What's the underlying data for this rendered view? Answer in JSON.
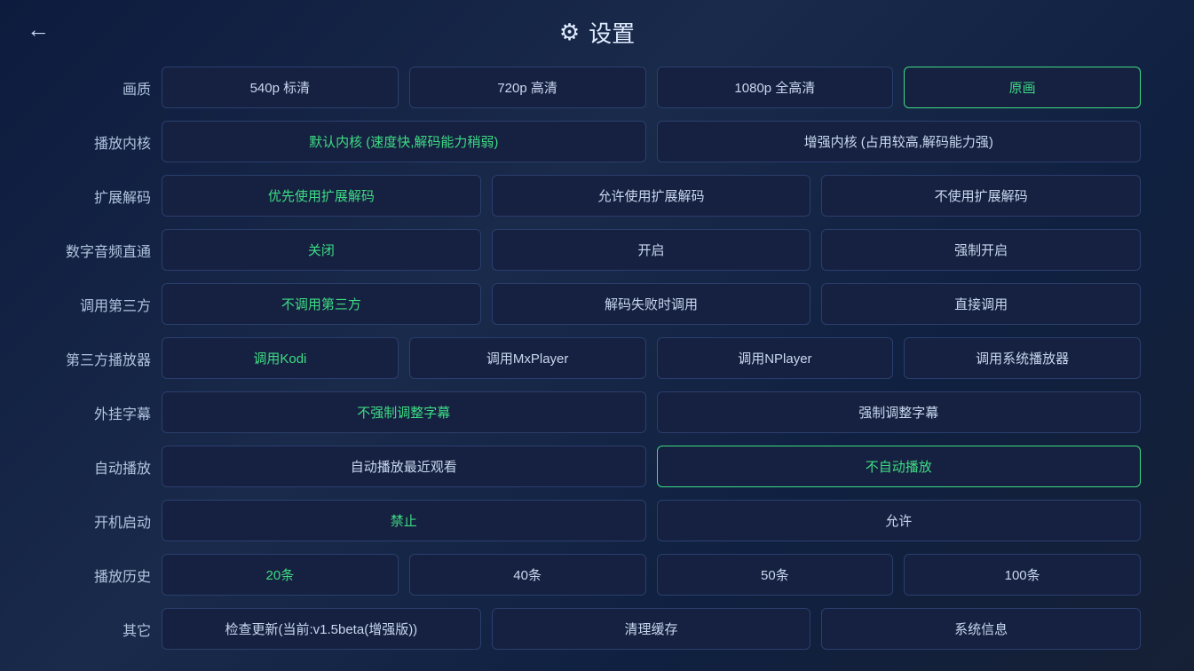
{
  "header": {
    "back_label": "←",
    "gear_symbol": "⚙",
    "title": "设置"
  },
  "rows": [
    {
      "label": "画质",
      "options": [
        {
          "text": "540p 标清",
          "state": "normal"
        },
        {
          "text": "720p 高清",
          "state": "normal"
        },
        {
          "text": "1080p 全高清",
          "state": "normal"
        },
        {
          "text": "原画",
          "state": "active-border-green"
        }
      ]
    },
    {
      "label": "播放内核",
      "options": [
        {
          "text": "默认内核 (速度快,解码能力稍弱)",
          "state": "active-green",
          "flex": 1
        },
        {
          "text": "增强内核 (占用较高,解码能力强)",
          "state": "normal",
          "flex": 1
        }
      ]
    },
    {
      "label": "扩展解码",
      "options": [
        {
          "text": "优先使用扩展解码",
          "state": "active-green"
        },
        {
          "text": "允许使用扩展解码",
          "state": "normal"
        },
        {
          "text": "不使用扩展解码",
          "state": "normal"
        }
      ]
    },
    {
      "label": "数字音频直通",
      "options": [
        {
          "text": "关闭",
          "state": "active-green"
        },
        {
          "text": "开启",
          "state": "normal"
        },
        {
          "text": "强制开启",
          "state": "normal"
        }
      ]
    },
    {
      "label": "调用第三方",
      "options": [
        {
          "text": "不调用第三方",
          "state": "active-green"
        },
        {
          "text": "解码失败时调用",
          "state": "normal"
        },
        {
          "text": "直接调用",
          "state": "normal"
        }
      ]
    },
    {
      "label": "第三方播放器",
      "options": [
        {
          "text": "调用Kodi",
          "state": "active-green"
        },
        {
          "text": "调用MxPlayer",
          "state": "normal"
        },
        {
          "text": "调用NPlayer",
          "state": "normal"
        },
        {
          "text": "调用系统播放器",
          "state": "normal"
        }
      ]
    },
    {
      "label": "外挂字幕",
      "options": [
        {
          "text": "不强制调整字幕",
          "state": "active-green",
          "flex": 1
        },
        {
          "text": "强制调整字幕",
          "state": "normal",
          "flex": 1
        }
      ]
    },
    {
      "label": "自动播放",
      "options": [
        {
          "text": "自动播放最近观看",
          "state": "normal",
          "flex": 1
        },
        {
          "text": "不自动播放",
          "state": "active-border-green",
          "flex": 1
        }
      ]
    },
    {
      "label": "开机启动",
      "options": [
        {
          "text": "禁止",
          "state": "active-green",
          "flex": 1
        },
        {
          "text": "允许",
          "state": "normal",
          "flex": 1
        }
      ]
    },
    {
      "label": "播放历史",
      "options": [
        {
          "text": "20条",
          "state": "active-green"
        },
        {
          "text": "40条",
          "state": "normal"
        },
        {
          "text": "50条",
          "state": "normal"
        },
        {
          "text": "100条",
          "state": "normal"
        }
      ]
    },
    {
      "label": "其它",
      "options": [
        {
          "text": "检查更新(当前:v1.5beta(增强版))",
          "state": "normal",
          "flex": 1
        },
        {
          "text": "清理缓存",
          "state": "normal",
          "flex": 1
        },
        {
          "text": "系统信息",
          "state": "normal",
          "flex": 1
        }
      ]
    }
  ]
}
